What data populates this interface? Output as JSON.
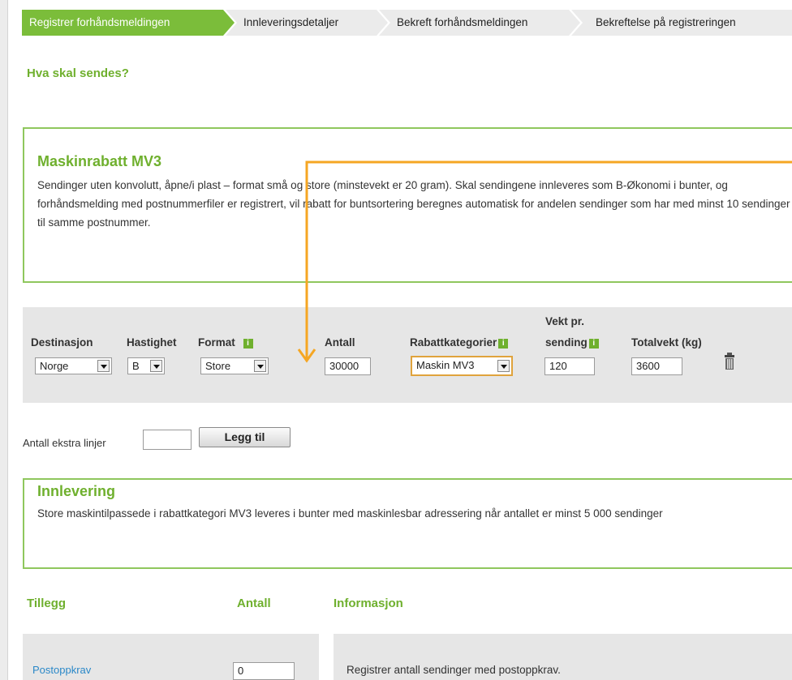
{
  "steps": [
    {
      "label": "Registrer forhåndsmeldingen",
      "active": true
    },
    {
      "label": "Innleveringsdetaljer",
      "active": false
    },
    {
      "label": "Bekreft forhåndsmeldingen",
      "active": false
    },
    {
      "label": "Bekreftelse på registreringen",
      "active": false
    }
  ],
  "section_title": "Hva skal sendes?",
  "product": {
    "title": "Maskinrabatt MV3",
    "description": "Sendinger uten konvolutt, åpne/i plast – format små og store (minstevekt er 20 gram). Skal sendingene innleveres som B-Økonomi i bunter, og forhåndsmelding med postnummerfiler er registrert, vil rabatt for buntsortering beregnes automatisk for andelen sendinger som har med minst 10 sendinger til samme postnummer."
  },
  "form": {
    "labels": {
      "destination": "Destinasjon",
      "speed": "Hastighet",
      "format": "Format",
      "quantity": "Antall",
      "discount": "Rabattkategorier",
      "weight_line1": "Vekt pr.",
      "weight_line2": "sending",
      "total": "Totalvekt (kg)"
    },
    "values": {
      "destination": "Norge",
      "speed": "B",
      "format": "Store",
      "quantity": "30000",
      "discount": "Maskin MV3",
      "weight": "120",
      "total": "3600"
    },
    "info_icon": "i"
  },
  "extra_lines": {
    "label": "Antall ekstra linjer",
    "value": "",
    "button": "Legg til"
  },
  "delivery": {
    "title": "Innlevering",
    "description": "Store maskintilpassede i rabattkategori MV3 leveres i bunter med maskinlesbar adressering når antallet er minst 5 000 sendinger"
  },
  "addons": {
    "headers": {
      "addon": "Tillegg",
      "count": "Antall",
      "info": "Informasjon"
    },
    "rows": [
      {
        "name": "Postoppkrav",
        "count": "0",
        "info": "Registrer antall sendinger med postoppkrav."
      }
    ]
  },
  "colors": {
    "accent": "#6fb02e",
    "annotation": "#f5a623",
    "link": "#2a88c8"
  }
}
